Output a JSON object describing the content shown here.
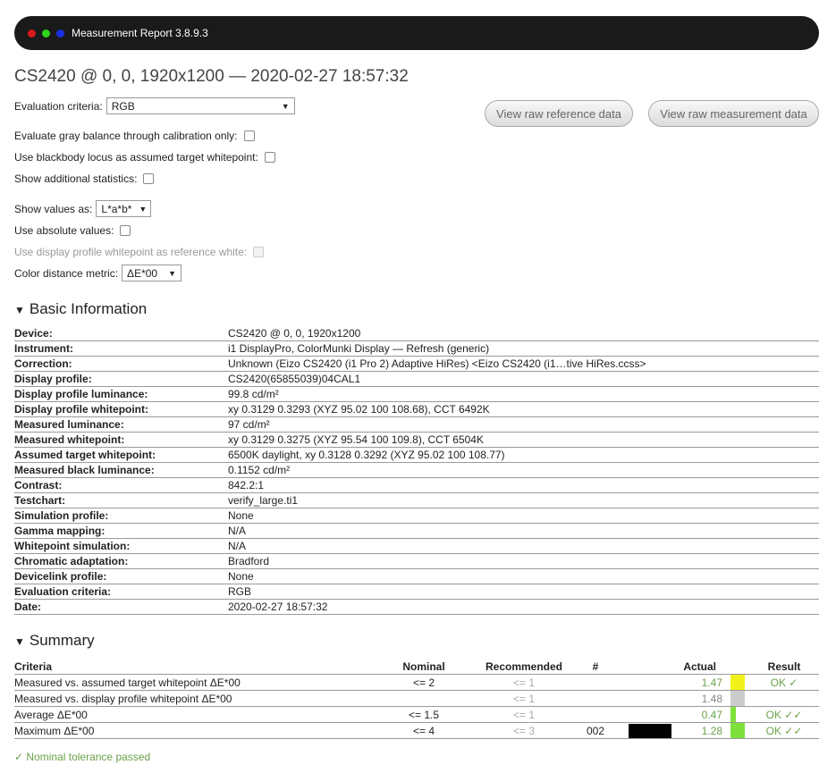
{
  "app": {
    "title": "Measurement Report 3.8.9.3"
  },
  "page_title": "CS2420 @ 0, 0, 1920x1200 — 2020-02-27 18:57:32",
  "options": {
    "evaluation_criteria": {
      "label": "Evaluation criteria:",
      "value": "RGB"
    },
    "gray_balance": {
      "label": "Evaluate gray balance through calibration only:",
      "checked": false
    },
    "blackbody": {
      "label": "Use blackbody locus as assumed target whitepoint:",
      "checked": false
    },
    "additional_stats": {
      "label": "Show additional statistics:",
      "checked": false
    },
    "show_values_as": {
      "label": "Show values as:",
      "value": "L*a*b*"
    },
    "absolute_values": {
      "label": "Use absolute values:",
      "checked": false
    },
    "profile_whitepoint": {
      "label": "Use display profile whitepoint as reference white:",
      "checked": false,
      "disabled": true
    },
    "distance_metric": {
      "label": "Color distance metric:",
      "value": "ΔE*00"
    }
  },
  "buttons": {
    "raw_reference": "View raw reference data",
    "raw_measurement": "View raw measurement data"
  },
  "basic_info": {
    "heading": "Basic Information",
    "toggle_glyph": "▼",
    "rows": [
      {
        "key": "Device:",
        "value": "CS2420 @ 0, 0, 1920x1200"
      },
      {
        "key": "Instrument:",
        "value": "i1 DisplayPro, ColorMunki Display — Refresh (generic)"
      },
      {
        "key": "Correction:",
        "value": "Unknown (Eizo CS2420 (i1 Pro 2) Adaptive HiRes) <Eizo CS2420 (i1…tive HiRes.ccss>"
      },
      {
        "key": "Display profile:",
        "value": "CS2420(65855039)04CAL1"
      },
      {
        "key": "Display profile luminance:",
        "value": "99.8 cd/m²"
      },
      {
        "key": "Display profile whitepoint:",
        "value": "xy 0.3129 0.3293 (XYZ 95.02 100 108.68), CCT 6492K"
      },
      {
        "key": "Measured luminance:",
        "value": "97 cd/m²"
      },
      {
        "key": "Measured whitepoint:",
        "value": "xy 0.3129 0.3275 (XYZ 95.54 100 109.8), CCT 6504K"
      },
      {
        "key": "Assumed target whitepoint:",
        "value": "6500K daylight, xy 0.3128 0.3292 (XYZ 95.02 100 108.77)"
      },
      {
        "key": "Measured black luminance:",
        "value": "0.1152 cd/m²"
      },
      {
        "key": "Contrast:",
        "value": "842.2:1"
      },
      {
        "key": "Testchart:",
        "value": "verify_large.ti1"
      },
      {
        "key": "Simulation profile:",
        "value": "None"
      },
      {
        "key": "Gamma mapping:",
        "value": "N/A"
      },
      {
        "key": "Whitepoint simulation:",
        "value": "N/A"
      },
      {
        "key": "Chromatic adaptation:",
        "value": "Bradford"
      },
      {
        "key": "Devicelink profile:",
        "value": "None"
      },
      {
        "key": "Evaluation criteria:",
        "value": "RGB"
      },
      {
        "key": "Date:",
        "value": "2020-02-27 18:57:32"
      }
    ]
  },
  "summary": {
    "heading": "Summary",
    "toggle_glyph": "▼",
    "headers": {
      "criteria": "Criteria",
      "nominal": "Nominal",
      "recommended": "Recommended",
      "num": "#",
      "actual": "Actual",
      "result": "Result"
    },
    "rows": [
      {
        "criteria": "Measured vs. assumed target whitepoint ΔE*00",
        "nominal": "<= 2",
        "recommended": "<= 1",
        "num": "",
        "swatch": "",
        "actual": "1.47",
        "bar_color": "#f2f21a",
        "bar_fill": 1.0,
        "result": "OK ✓",
        "muted": false
      },
      {
        "criteria": "Measured vs. display profile whitepoint ΔE*00",
        "nominal": "",
        "recommended": "<= 1",
        "num": "",
        "swatch": "",
        "actual": "1.48",
        "bar_color": "#cccccc",
        "bar_fill": 1.0,
        "result": "",
        "muted": true
      },
      {
        "criteria": "Average ΔE*00",
        "nominal": "<= 1.5",
        "recommended": "<= 1",
        "num": "",
        "swatch": "",
        "actual": "0.47",
        "bar_color": "#7ee03a",
        "bar_fill": 0.35,
        "result": "OK ✓✓",
        "muted": false
      },
      {
        "criteria": "Maximum ΔE*00",
        "nominal": "<= 4",
        "recommended": "<= 3",
        "num": "002",
        "swatch": "#000000",
        "actual": "1.28",
        "bar_color": "#7ee03a",
        "bar_fill": 1.0,
        "result": "OK ✓✓",
        "muted": false
      }
    ]
  },
  "footer_note": "✓ Nominal tolerance passed"
}
